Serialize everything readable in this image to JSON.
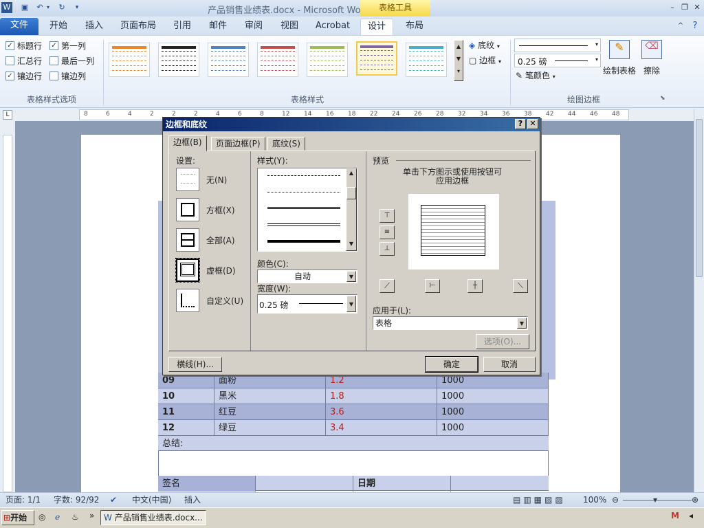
{
  "window": {
    "title": "产品销售业绩表.docx - Microsoft Word",
    "context_tab_group": "表格工具"
  },
  "tabs": [
    "文件",
    "开始",
    "插入",
    "页面布局",
    "引用",
    "邮件",
    "审阅",
    "视图",
    "Acrobat",
    "设计",
    "布局"
  ],
  "ribbon": {
    "style_options": {
      "items": [
        {
          "label": "标题行",
          "checked": true
        },
        {
          "label": "第一列",
          "checked": true
        },
        {
          "label": "汇总行",
          "checked": false
        },
        {
          "label": "最后一列",
          "checked": false
        },
        {
          "label": "镶边行",
          "checked": true
        },
        {
          "label": "镶边列",
          "checked": false
        }
      ],
      "group_label": "表格样式选项"
    },
    "styles_group_label": "表格样式",
    "shading_label": "底纹",
    "border_label": "边框",
    "pen_weight": "0.25 磅",
    "pen_color_label": "笔颜色",
    "draw_table_label": "绘制表格",
    "eraser_label": "擦除",
    "draw_borders_group_label": "绘图边框",
    "style_colors": [
      "#e8862c",
      "#222222",
      "#4f81bd",
      "#c0504d",
      "#9bbb59",
      "#8064a2",
      "#4bacc6"
    ]
  },
  "ruler_numbers": [
    "8",
    "6",
    "4",
    "2",
    "2",
    "2",
    "4",
    "6",
    "8",
    "12",
    "14",
    "16",
    "18",
    "22",
    "24",
    "26",
    "28",
    "32",
    "34",
    "36",
    "38",
    "42",
    "44",
    "46",
    "48"
  ],
  "table": {
    "rows": [
      {
        "no": "09",
        "name": "面粉",
        "price": "1.2",
        "qty": "1000"
      },
      {
        "no": "10",
        "name": "黑米",
        "price": "1.8",
        "qty": "1000"
      },
      {
        "no": "11",
        "name": "红豆",
        "price": "3.6",
        "qty": "1000"
      },
      {
        "no": "12",
        "name": "绿豆",
        "price": "3.4",
        "qty": "1000"
      }
    ],
    "summary_label": "总结:",
    "sign_label": "签名",
    "date_label": "日期"
  },
  "dialog": {
    "title": "边框和底纹",
    "tabs": [
      "边框(B)",
      "页面边框(P)",
      "底纹(S)"
    ],
    "settings_label": "设置:",
    "settings": [
      "无(N)",
      "方框(X)",
      "全部(A)",
      "虚框(D)",
      "自定义(U)"
    ],
    "style_label": "样式(Y):",
    "color_label": "颜色(C):",
    "color_value": "自动",
    "width_label": "宽度(W):",
    "width_value": "0.25 磅",
    "preview_label": "预览",
    "preview_hint_1": "单击下方图示或使用按钮可",
    "preview_hint_2": "应用边框",
    "apply_to_label": "应用于(L):",
    "apply_to_value": "表格",
    "options_button": "选项(O)...",
    "horizontal_line_button": "横线(H)...",
    "ok_button": "确定",
    "cancel_button": "取消"
  },
  "status": {
    "page": "页面: 1/1",
    "words": "字数: 92/92",
    "language": "中文(中国)",
    "mode": "插入",
    "zoom": "100%"
  },
  "taskbar": {
    "start": "开始",
    "window_item": "产品销售业绩表.docx..."
  }
}
